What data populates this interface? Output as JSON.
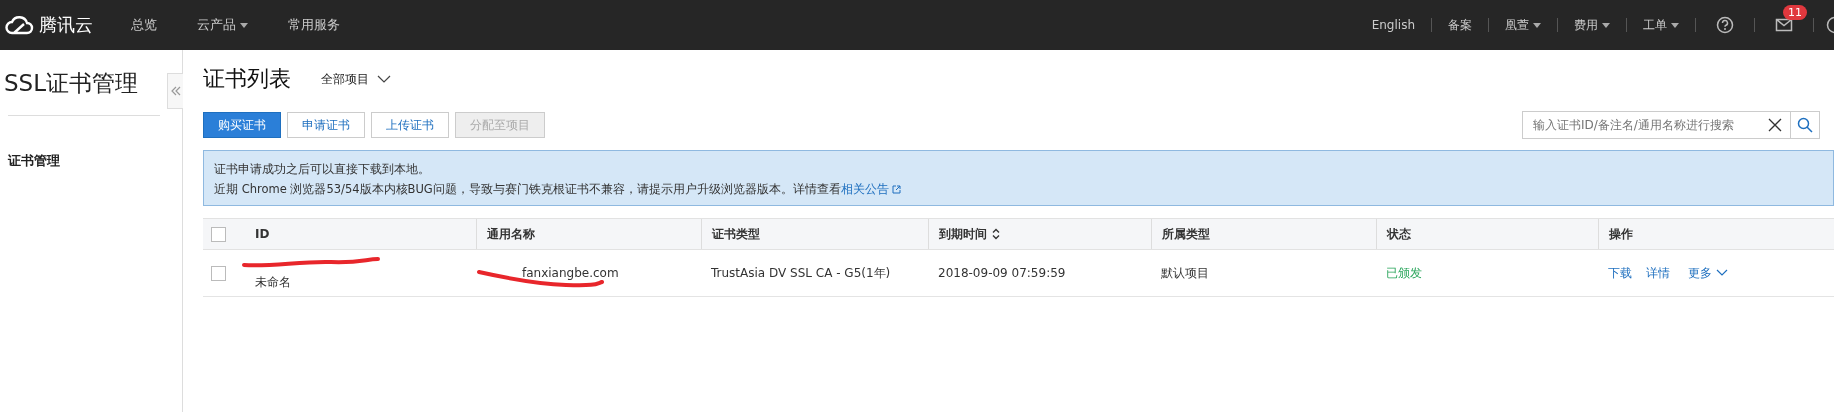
{
  "topbar": {
    "logo": "腾讯云",
    "nav": [
      {
        "label": "总览",
        "has_menu": false
      },
      {
        "label": "云产品",
        "has_menu": true
      },
      {
        "label": "常用服务",
        "has_menu": false
      }
    ],
    "right": [
      {
        "label": "English",
        "has_menu": false
      },
      {
        "label": "备案",
        "has_menu": false
      },
      {
        "label": "凰萱",
        "has_menu": true
      },
      {
        "label": "费用",
        "has_menu": true
      },
      {
        "label": "工单",
        "has_menu": true
      }
    ],
    "message_badge": "11"
  },
  "sidebar": {
    "title": "SSL证书管理",
    "items": [
      {
        "label": "证书管理",
        "selected": true
      }
    ]
  },
  "page": {
    "title": "证书列表",
    "project_filter": "全部项目",
    "buttons": [
      {
        "label": "购买证书",
        "kind": "primary"
      },
      {
        "label": "申请证书",
        "kind": "default"
      },
      {
        "label": "上传证书",
        "kind": "default"
      },
      {
        "label": "分配至项目",
        "kind": "disabled"
      }
    ],
    "search": {
      "placeholder": "输入证书ID/备注名/通用名称进行搜索"
    },
    "notice": {
      "line_1": "证书申请成功之后可以直接下载到本地。",
      "line_2": "近期 Chrome 浏览器53/54版本内核BUG问题，导致与赛门铁克根证书不兼容，请提示用户升级浏览器版本。详情查看",
      "link": "相关公告"
    }
  },
  "table": {
    "columns": [
      "ID",
      "通用名称",
      "证书类型",
      "到期时间",
      "所属类型",
      "状态",
      "操作"
    ],
    "select_all_checked": false,
    "rows": [
      {
        "checked": false,
        "remark": "未命名",
        "common_name": "fanxiangbe.com",
        "type": "TrustAsia DV SSL CA - G5(1年)",
        "expires": "2018-09-09 07:59:59",
        "project": "默认项目",
        "status": "已颁发",
        "actions": [
          "下载",
          "详情",
          "更多"
        ]
      }
    ]
  }
}
